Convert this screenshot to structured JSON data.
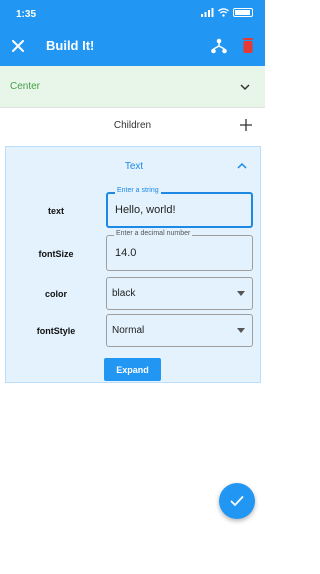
{
  "status_bar": {
    "time": "1:35"
  },
  "app_bar": {
    "title": "Build It!",
    "color": "#2196f3"
  },
  "center_node": {
    "label": "Center",
    "color": "#43a047",
    "expanded": false
  },
  "children": {
    "label": "Children"
  },
  "text_widget": {
    "title": "Text",
    "expanded": true,
    "properties": {
      "text": {
        "label": "text",
        "hint": "Enter a string",
        "value": "Hello, world!"
      },
      "fontSize": {
        "label": "fontSize",
        "hint": "Enter a decimal number",
        "value": "14.0"
      },
      "color": {
        "label": "color",
        "value": "black"
      },
      "fontStyle": {
        "label": "fontStyle",
        "value": "Normal"
      }
    },
    "expand_button": "Expand"
  },
  "icons": {
    "close": "close-icon",
    "tree": "tree-structure-icon",
    "trash": "trash-icon",
    "add": "plus-icon",
    "confirm": "checkmark-icon"
  }
}
